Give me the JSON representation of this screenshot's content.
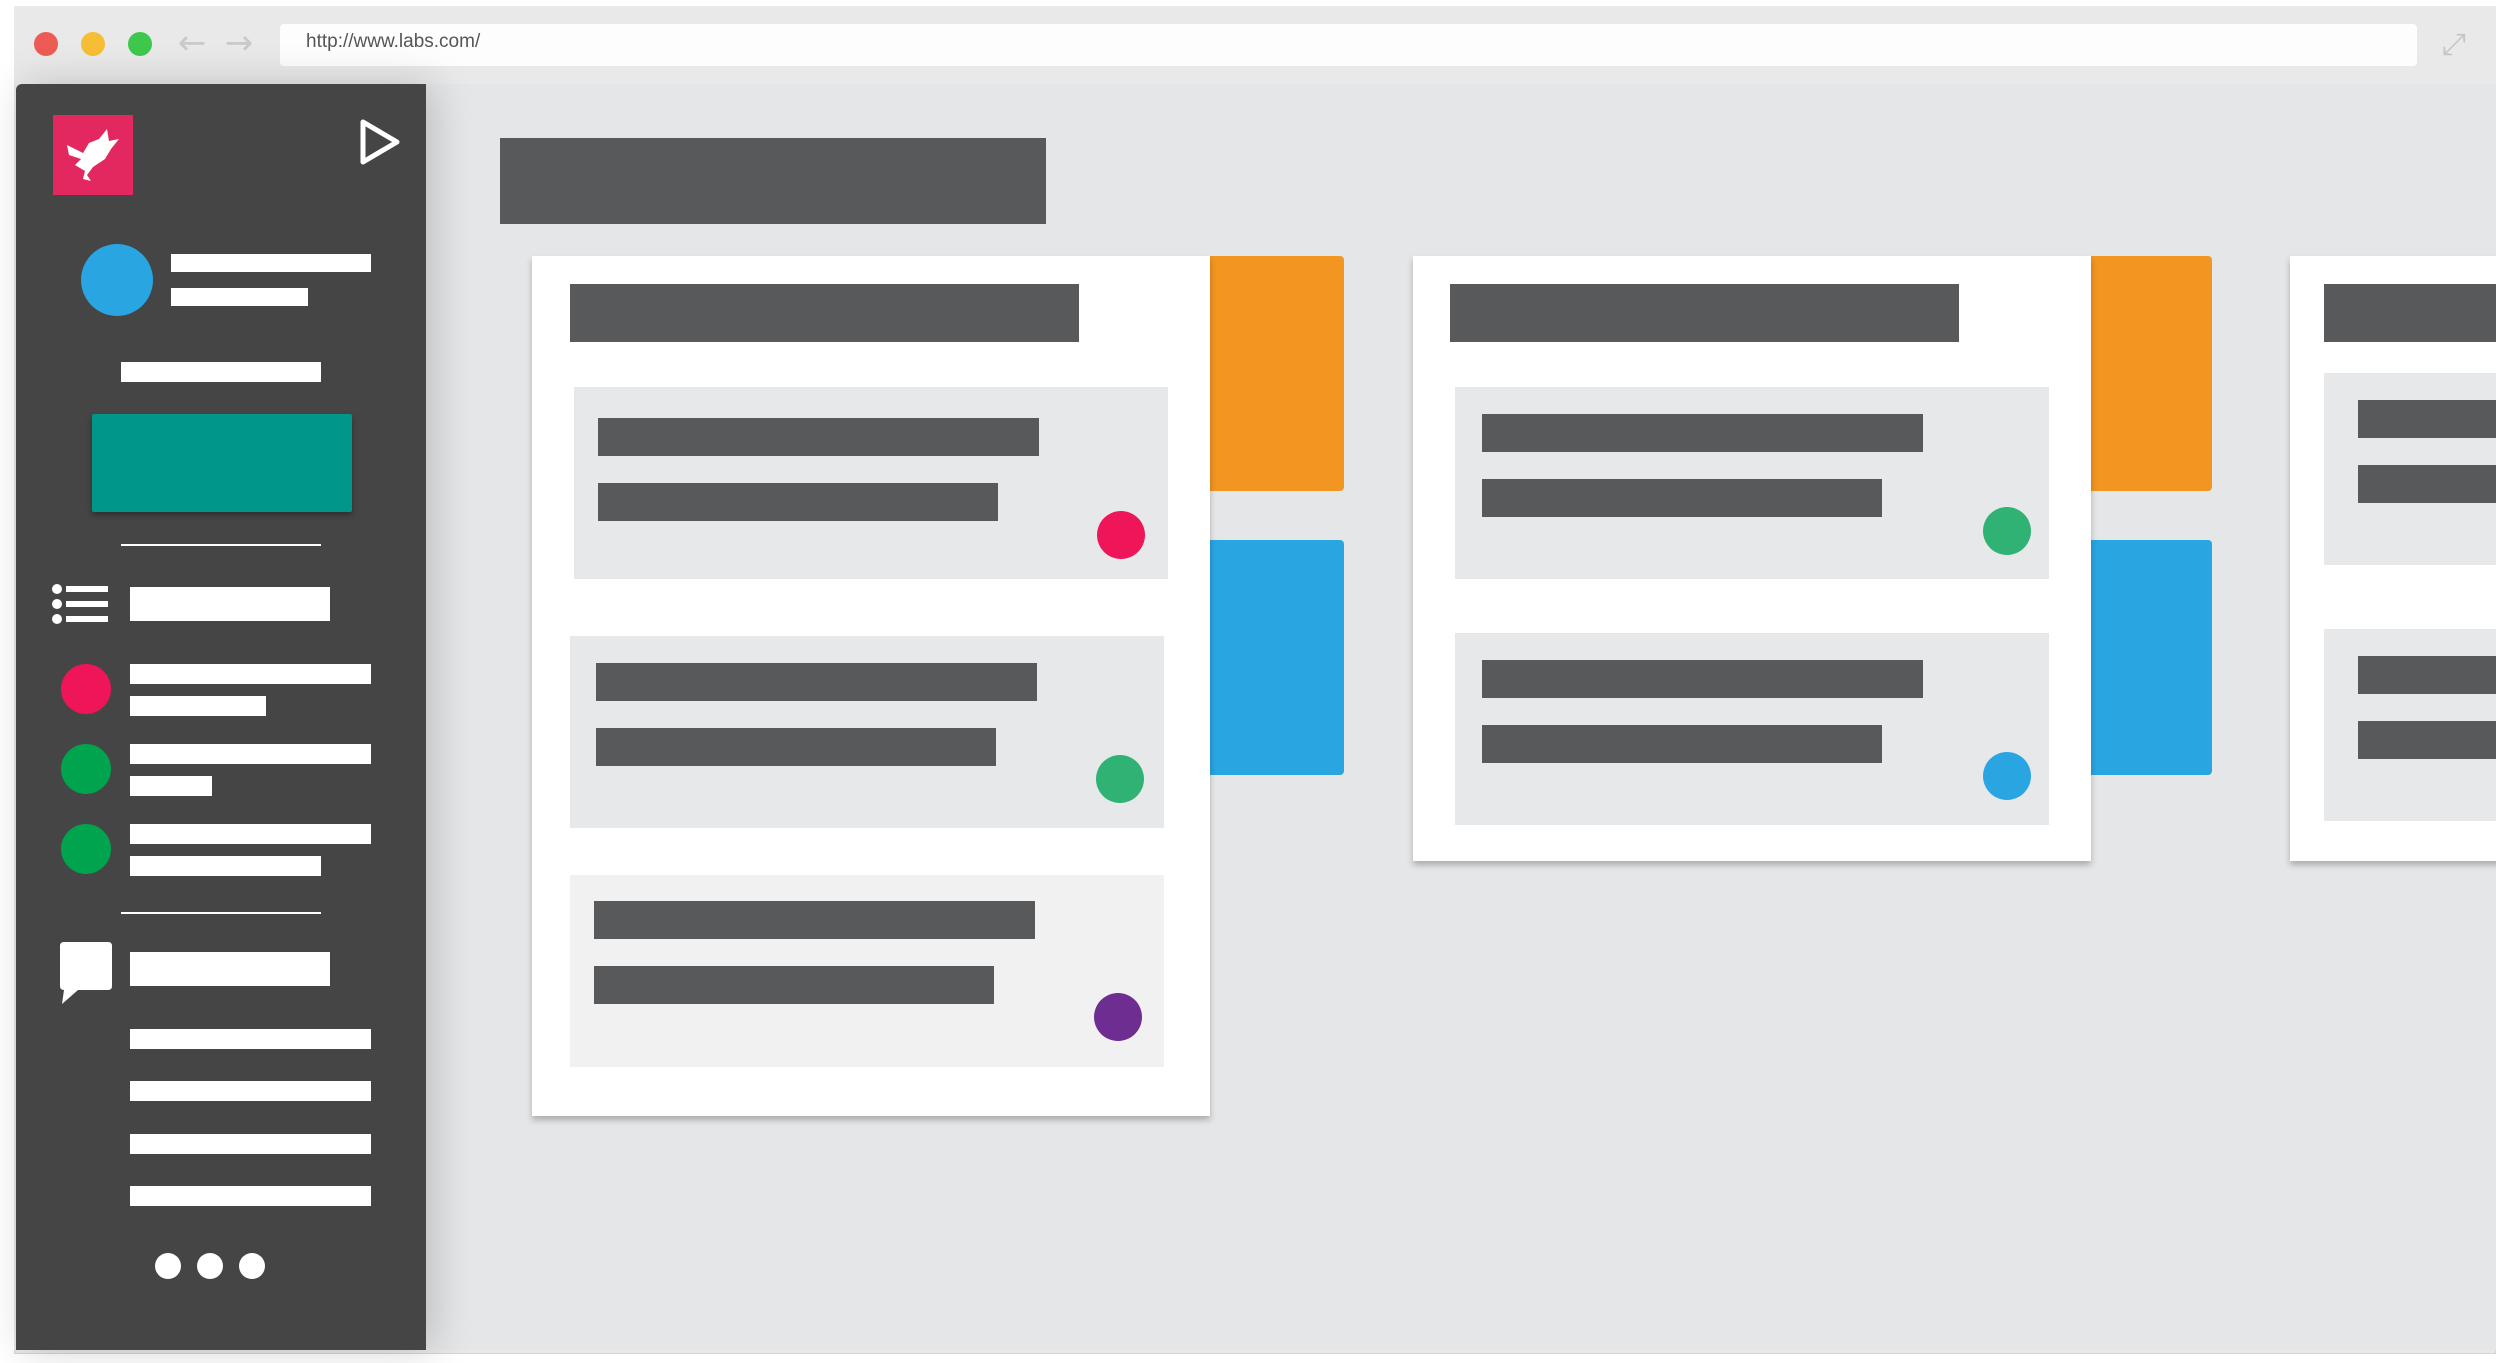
{
  "browser": {
    "url": "http://www.labs.com/",
    "traffic_lights": {
      "close": "#ee5b55",
      "minimize": "#f6be34",
      "maximize": "#3ec84b"
    },
    "back_icon": "arrow-left-icon",
    "forward_icon": "arrow-right-icon",
    "expand_icon": "expand-icon"
  },
  "sidebar": {
    "logo_icon": "bird-logo-icon",
    "logo_color": "#e2285e",
    "collapse_icon": "play-triangle-icon",
    "profile_color": "#29a6e2",
    "primary_button_color": "#00978a",
    "list_icon": "list-icon",
    "status_dots": [
      "#ee1559",
      "#00a34e",
      "#00a34e"
    ],
    "chat_icon": "chat-bubble-icon",
    "more_icon": "more-dots-icon"
  },
  "board": {
    "columns": [
      {
        "tab_colors": [
          "#f39521",
          "#29a6e2"
        ],
        "item_dots": [
          "#ee1559",
          "#2fb274",
          "#6d2d91"
        ]
      },
      {
        "tab_colors": [
          "#f39521",
          "#29a6e2"
        ],
        "item_dots": [
          "#2fb274",
          "#29a6e2"
        ]
      },
      {
        "tab_colors": [],
        "item_dots": []
      }
    ]
  }
}
